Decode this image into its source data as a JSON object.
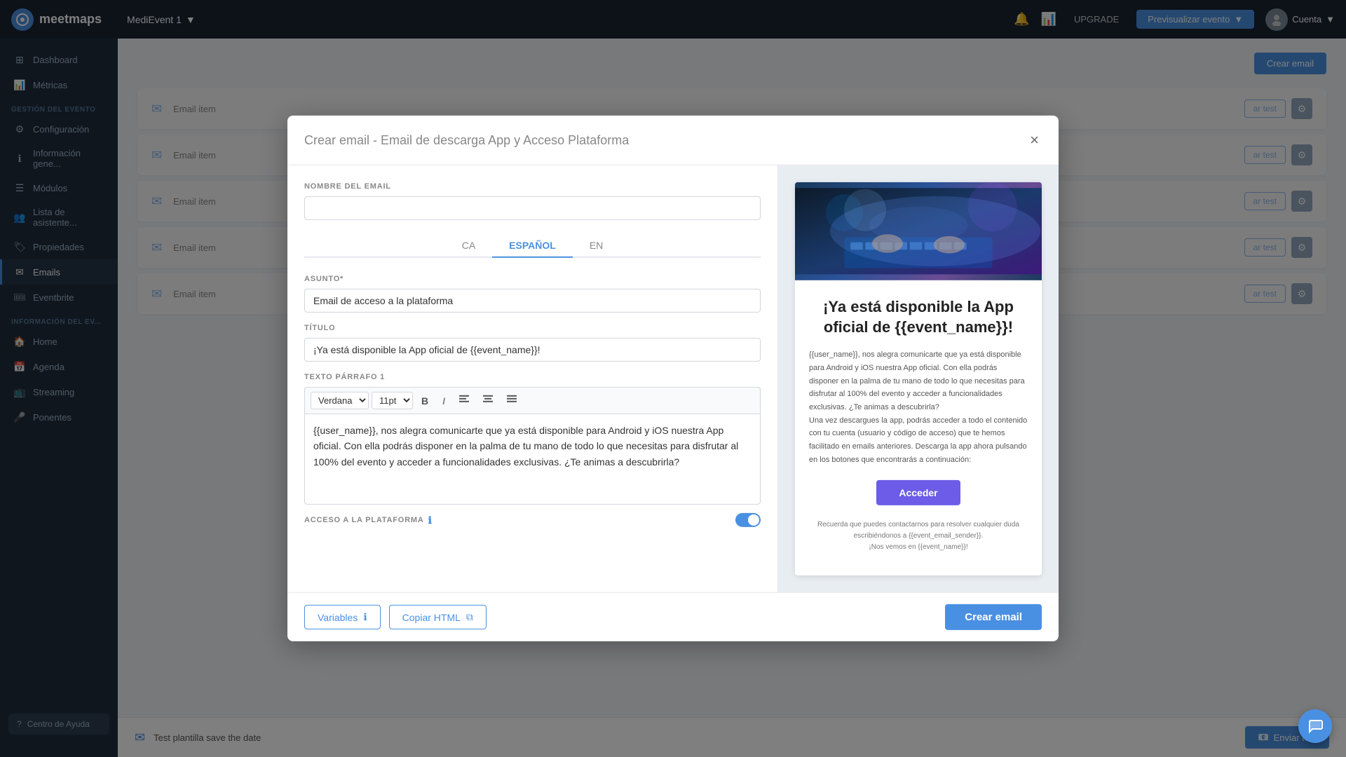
{
  "app": {
    "name": "meetmaps",
    "logo_letter": "m"
  },
  "navbar": {
    "event_name": "MediEvent 1",
    "upgrade_label": "UPGRADE",
    "preview_label": "Previsualizar evento",
    "cuenta_label": "Cuenta",
    "bell_icon": "🔔",
    "chart_icon": "📊",
    "dropdown_icon": "▼",
    "avatar_initials": ""
  },
  "sidebar": {
    "section_gestion": "GESTIÓN DEL EVENTO",
    "section_info": "INFORMACIÓN DEL EV...",
    "items_top": [
      {
        "label": "Dashboard",
        "icon": "⊞"
      },
      {
        "label": "Métricas",
        "icon": "📊"
      }
    ],
    "items_gestion": [
      {
        "label": "Configuración",
        "icon": "⚙"
      },
      {
        "label": "Información gene...",
        "icon": "ℹ"
      },
      {
        "label": "Módulos",
        "icon": "☰"
      },
      {
        "label": "Lista de asistente...",
        "icon": "👥"
      },
      {
        "label": "Propiedades",
        "icon": "🏷"
      },
      {
        "label": "Emails",
        "icon": "✉",
        "active": true
      },
      {
        "label": "Eventbrite",
        "icon": "🎟"
      }
    ],
    "items_info": [
      {
        "label": "Home",
        "icon": "🏠"
      },
      {
        "label": "Agenda",
        "icon": "📅"
      },
      {
        "label": "Streaming",
        "icon": "📺"
      },
      {
        "label": "Ponentes",
        "icon": "🎤"
      }
    ],
    "help_label": "Centro de Ayuda"
  },
  "modal": {
    "title": "Crear email",
    "subtitle": " - Email de descarga App y Acceso Plataforma",
    "close_icon": "×",
    "nombre_label": "NOMBRE DEL EMAIL",
    "nombre_placeholder": "",
    "lang_tabs": [
      "CA",
      "ESPAÑOL",
      "EN"
    ],
    "active_lang": "ESPAÑOL",
    "asunto_label": "ASUNTO*",
    "asunto_value": "Email de acceso a la plataforma",
    "titulo_label": "TÍTULO",
    "titulo_value": "¡Ya está disponible la App oficial de {{event_name}}!",
    "parrafo_label": "TEXTO PÁRRAFO 1",
    "font_family": "Verdana",
    "font_size": "11pt",
    "parrafo_content": "{{user_name}}, nos alegra comunicarte que ya está disponible para Android y iOS nuestra App oficial. Con ella podrás disponer en la palma de tu mano de todo lo que necesitas para disfrutar al 100% del evento y acceder a funcionalidades exclusivas. ¿Te animas a descubrirla?",
    "acceso_label": "ACCESO A LA PLATAFORMA",
    "variables_label": "Variables",
    "copiar_html_label": "Copiar HTML",
    "crear_email_label": "Crear email",
    "info_icon": "ℹ",
    "copy_icon": "⧉"
  },
  "preview": {
    "title": "¡Ya está disponible la App oficial de {{event_name}}!",
    "body_text": "{{user_name}}, nos alegra comunicarte que ya está disponible para Android y iOS nuestra App oficial. Con ella podrás disponer en la palma de tu mano de todo lo que necesitas para disfrutar al 100% del evento y acceder a funcionalidades exclusivas. ¿Te animas a descubrirla?\nUna vez descargues la app, podrás acceder a todo el contenido con tu cuenta (usuario y código de acceso) que te hemos facilitado en emails anteriores. Descarga la app ahora pulsando en los botones que encontrarás a continuación:",
    "cta_label": "Acceder",
    "footer_text": "Recuerda que puedes contactarnos para resolver cualquier duda escribiéndonos a {{event_email_sender}}.\n¡Nos vemos en {{event_name}}!"
  },
  "background": {
    "crear_btn": "Crear email",
    "email_items": [
      {
        "name": "Test plantilla save the date"
      }
    ],
    "test_label": "ar test",
    "enviar_test_label": "Enviar test"
  }
}
